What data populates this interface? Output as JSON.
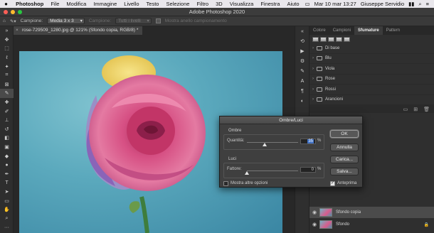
{
  "menubar": {
    "apple": "",
    "items": [
      "Photoshop",
      "File",
      "Modifica",
      "Immagine",
      "Livello",
      "Testo",
      "Selezione",
      "Filtro",
      "3D",
      "Visualizza",
      "Finestra",
      "Aiuto"
    ],
    "clock": "Mar 10 mar  13:27",
    "user": "Giuseppe Servidio"
  },
  "window": {
    "title": "Adobe Photoshop 2020"
  },
  "options_bar": {
    "campione_label": "Campione:",
    "campione_value": "Media 3 x 3",
    "campione2_label": "Campione:",
    "campione2_value": "Tutti i livelli",
    "mostra_anello": "Mostra anello campionamento"
  },
  "document": {
    "tab_title": "rose-729509_1280.jpg @ 121% (Sfondo copia, RGB/8) *"
  },
  "right_panel": {
    "tabs": [
      "Colore",
      "Campioni",
      "Sfumature",
      "Pattern"
    ],
    "active_tab": "Sfumature",
    "folders": [
      "Di base",
      "Blu",
      "Viola",
      "Rose",
      "Rossi",
      "Arancioni"
    ]
  },
  "layers": [
    {
      "name": "Sfondo copia",
      "selected": true
    },
    {
      "name": "Sfondo",
      "selected": false
    }
  ],
  "dialog": {
    "title": "Ombre/Luci",
    "shadows_group": "Ombre",
    "amount_label": "Quantità:",
    "amount_value": "35",
    "amount_unit": "%",
    "highlights_group": "Luci",
    "factor_label": "Fattore:",
    "factor_value": "0",
    "factor_unit": "%",
    "more_options": "Mostra altre opzioni",
    "preview": "Anteprima",
    "amount_fraction": 0.35,
    "factor_fraction": 0.0,
    "buttons": {
      "ok": "OK",
      "cancel": "Annulla",
      "load": "Carica...",
      "save": "Salva..."
    }
  }
}
